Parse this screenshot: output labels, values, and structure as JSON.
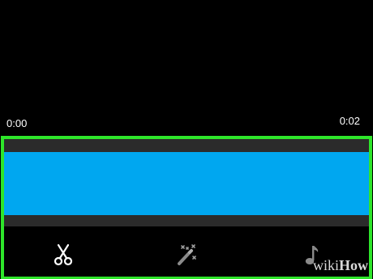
{
  "player": {
    "time_start": "0:00",
    "time_end": "0:02"
  },
  "colors": {
    "highlight_border": "#2ee62a",
    "clip": "#00a7f0",
    "track": "#2b2b2b",
    "background": "#000000"
  },
  "toolbar": {
    "tools": [
      {
        "icon": "scissors-icon",
        "name": "trim"
      },
      {
        "icon": "magic-wand-icon",
        "name": "effects"
      },
      {
        "icon": "music-note-icon",
        "name": "music"
      }
    ]
  },
  "watermark": {
    "prefix": "wiki",
    "suffix": "How"
  }
}
